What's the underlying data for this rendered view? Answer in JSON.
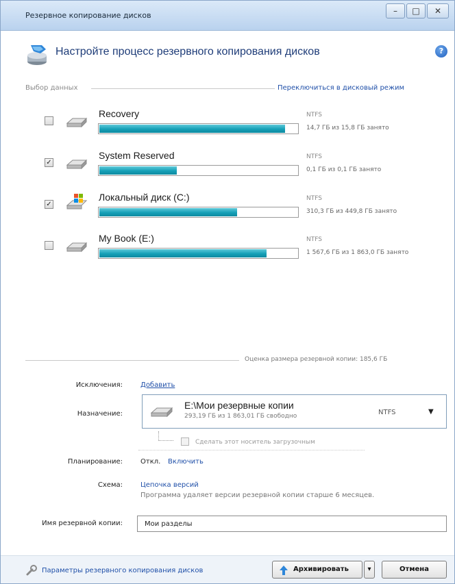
{
  "window": {
    "title": "Резервное копирование дисков",
    "minimize_glyph": "–",
    "maximize_glyph": "□",
    "close_glyph": "✕"
  },
  "header": {
    "title": "Настройте процесс резервного копирования дисков",
    "icon": "backup-wizard-icon",
    "help_glyph": "?"
  },
  "data_selection": {
    "label": "Выбор данных",
    "switch_link": "Переключиться в дисковый режим"
  },
  "disks": [
    {
      "name": "Recovery",
      "checked": false,
      "fs": "NTFS",
      "usage": "14,7 ГБ из 15,8 ГБ занято",
      "fill": 0.93,
      "icon": "hard-drive-icon"
    },
    {
      "name": "System Reserved",
      "checked": true,
      "fs": "NTFS",
      "usage": "0,1 ГБ из 0,1 ГБ занято",
      "fill": 0.39,
      "icon": "hard-drive-icon"
    },
    {
      "name": "Локальный диск (C:)",
      "checked": true,
      "fs": "NTFS",
      "usage": "310,3 ГБ из 449,8 ГБ занято",
      "fill": 0.69,
      "icon": "windows-drive-icon"
    },
    {
      "name": "My Book (E:)",
      "checked": false,
      "fs": "NTFS",
      "usage": "1 567,6 ГБ из 1 863,0 ГБ занято",
      "fill": 0.84,
      "icon": "hard-drive-icon"
    }
  ],
  "estimate": {
    "label": "Оценка размера резервной копии: 185,6 ГБ"
  },
  "exclusions": {
    "label": "Исключения:",
    "link": "Добавить"
  },
  "destination": {
    "label": "Назначение:",
    "path": "E:\\Мои резервные копии",
    "free": "293,19 ГБ из 1 863,01 ГБ свободно",
    "fs": "NTFS",
    "arrow": "▼",
    "bootable_label": "Сделать этот носитель загрузочным"
  },
  "schedule": {
    "label": "Планирование:",
    "value": "Откл.",
    "link": "Включить"
  },
  "scheme": {
    "label": "Схема:",
    "link": "Цепочка версий",
    "description": "Программа удаляет версии резервной копии старше 6 месяцев."
  },
  "backup_name": {
    "label": "Имя резервной копии:",
    "value": "Мои разделы"
  },
  "footer": {
    "settings_link": "Параметры резервного копирования дисков",
    "archive_button": "Архивировать",
    "archive_arrow": "▾",
    "cancel_button": "Отмена"
  },
  "colors": {
    "progress_fill": "#15a0b7",
    "link": "#1f4fa8",
    "title": "#1e3c78"
  }
}
